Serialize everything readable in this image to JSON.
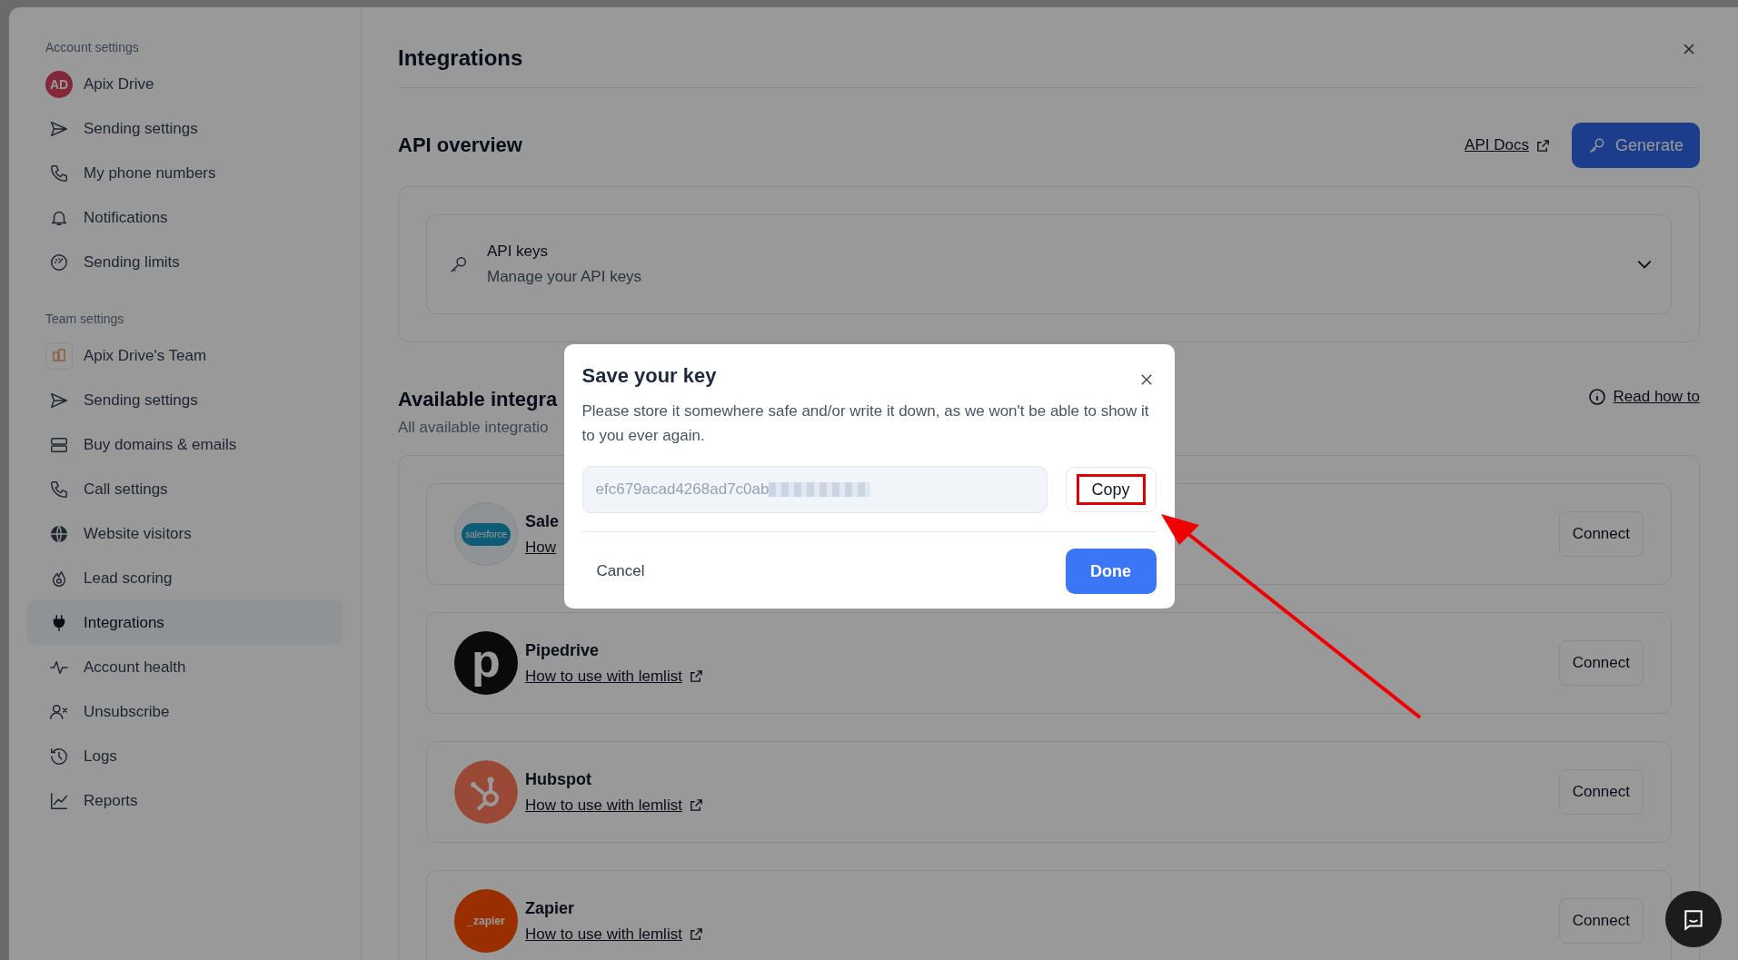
{
  "sidebar": {
    "sections": [
      {
        "heading": "Account settings",
        "items": [
          {
            "label": "Apix Drive",
            "kind": "avatar",
            "avatar_text": "AD",
            "selected": false
          },
          {
            "label": "Sending settings",
            "kind": "send",
            "selected": false
          },
          {
            "label": "My phone numbers",
            "kind": "phone",
            "selected": false
          },
          {
            "label": "Notifications",
            "kind": "bell",
            "selected": false
          },
          {
            "label": "Sending limits",
            "kind": "gauge",
            "selected": false
          }
        ]
      },
      {
        "heading": "Team settings",
        "items": [
          {
            "label": "Apix Drive's Team",
            "kind": "team",
            "selected": false
          },
          {
            "label": "Sending settings",
            "kind": "send",
            "selected": false
          },
          {
            "label": "Buy domains & emails",
            "kind": "servers",
            "selected": false
          },
          {
            "label": "Call settings",
            "kind": "phone",
            "selected": false
          },
          {
            "label": "Website visitors",
            "kind": "globe",
            "selected": false
          },
          {
            "label": "Lead scoring",
            "kind": "flame",
            "selected": false
          },
          {
            "label": "Integrations",
            "kind": "plug",
            "selected": true
          },
          {
            "label": "Account health",
            "kind": "pulse",
            "selected": false
          },
          {
            "label": "Unsubscribe",
            "kind": "userx",
            "selected": false
          },
          {
            "label": "Logs",
            "kind": "history",
            "selected": false
          },
          {
            "label": "Reports",
            "kind": "chart",
            "selected": false
          }
        ]
      }
    ]
  },
  "page": {
    "title": "Integrations"
  },
  "api_overview": {
    "title": "API overview",
    "docs_link": "API Docs",
    "generate_button": "Generate",
    "card": {
      "title": "API keys",
      "subtitle": "Manage your API keys",
      "expanded": false
    }
  },
  "available": {
    "title": "Available integra",
    "subtitle": "All available integratio",
    "read_link": "Read how to",
    "items": [
      {
        "name": "Sale",
        "link": "How",
        "kind": "salesforce",
        "logo_text": "salesforce",
        "connect_button": "Connect"
      },
      {
        "name": "Pipedrive",
        "link": "How to use with lemlist",
        "kind": "pipedrive",
        "logo_text": "p",
        "connect_button": "Connect"
      },
      {
        "name": "Hubspot",
        "link": "How to use with lemlist",
        "kind": "hubspot",
        "connect_button": "Connect"
      },
      {
        "name": "Zapier",
        "link": "How to use with lemlist",
        "kind": "zapier",
        "logo_text": "_zapier",
        "connect_button": "Connect"
      }
    ]
  },
  "modal": {
    "title": "Save your key",
    "message": "Please store it somewhere safe and/or write it down, as we won't be able to show it to you ever again.",
    "key_value": "efc679acad4268ad7c0ab",
    "key_redacted": true,
    "copy_button": "Copy",
    "cancel_button": "Cancel",
    "done_button": "Done"
  }
}
